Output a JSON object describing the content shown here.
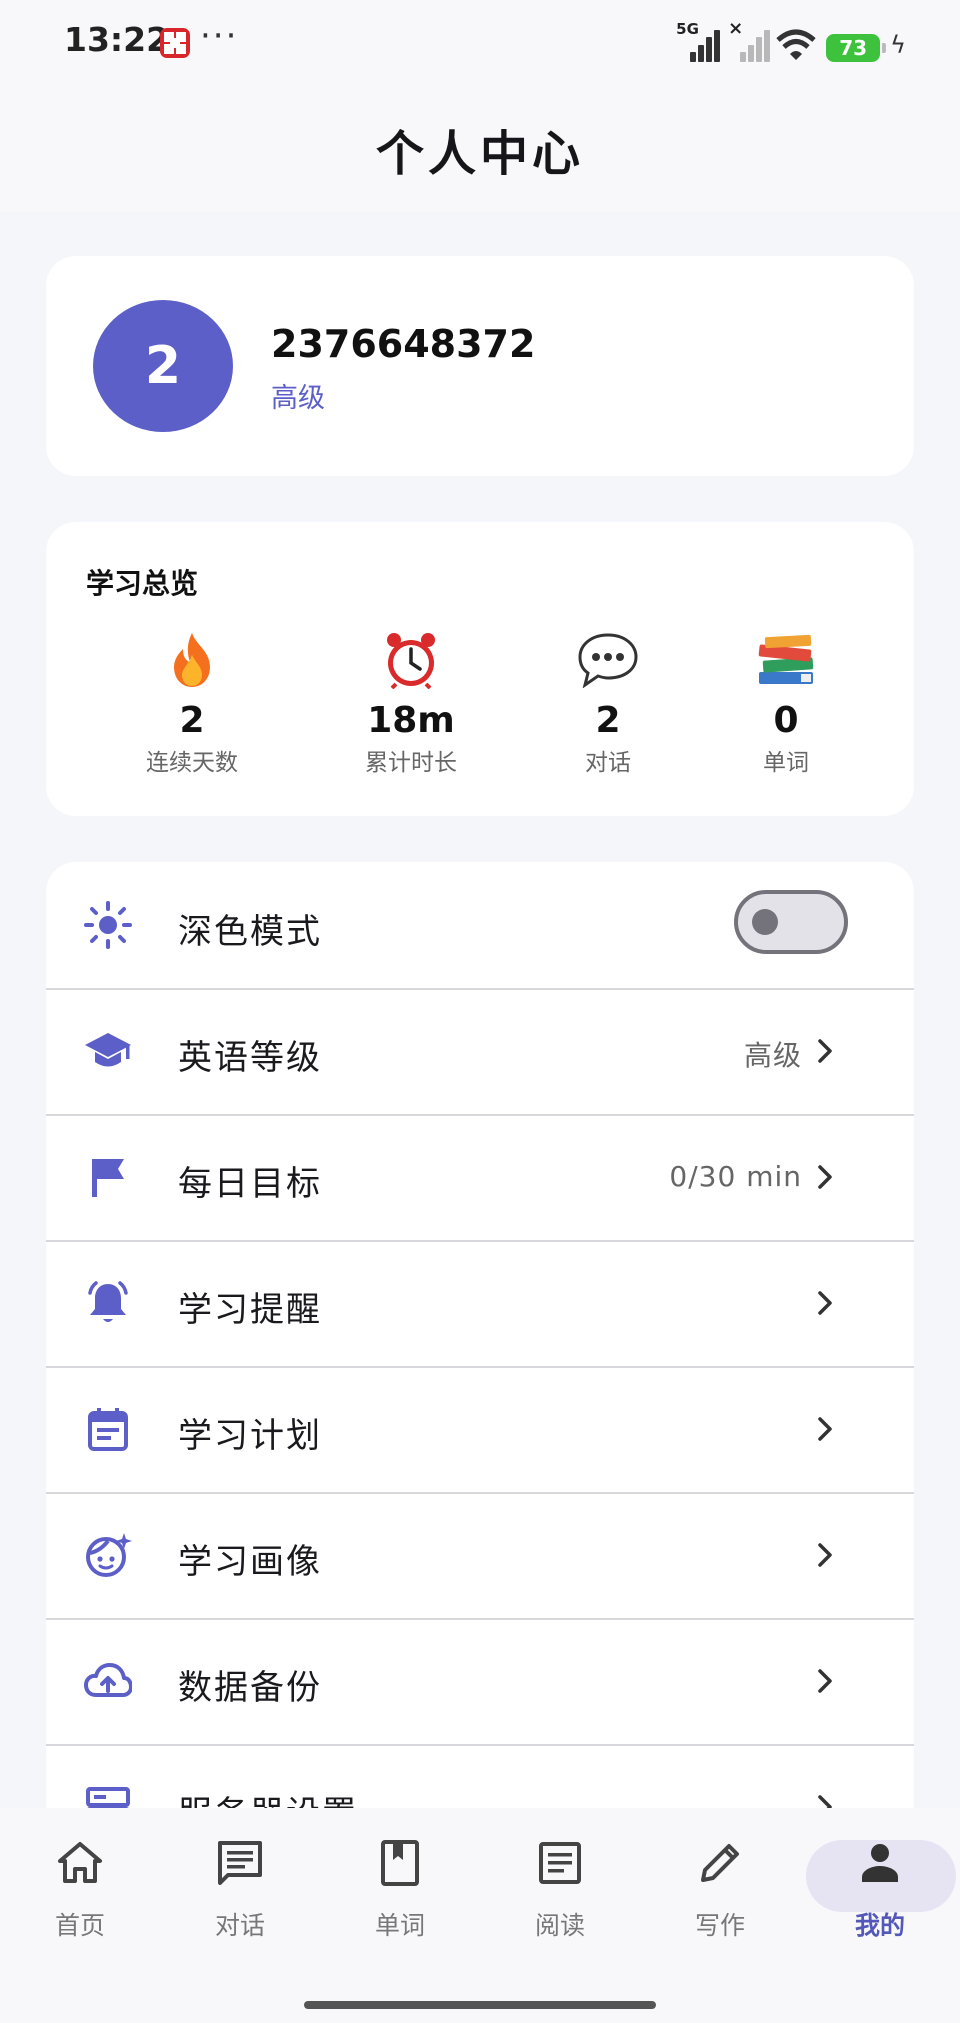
{
  "status_bar": {
    "time": "13:22",
    "dots": "···",
    "network_label": "5G",
    "battery": "73",
    "icons": [
      "app-notification-icon",
      "signal-icon",
      "signal-off-icon",
      "wifi-icon",
      "battery-icon",
      "charging-icon"
    ]
  },
  "header": {
    "title": "个人中心"
  },
  "profile": {
    "avatar_letter": "2",
    "username": "2376648372",
    "level": "高级",
    "avatar_color": "#5c5fc8"
  },
  "overview": {
    "title": "学习总览",
    "stats": [
      {
        "icon": "fire-icon",
        "value": "2",
        "label": "连续天数"
      },
      {
        "icon": "alarm-clock-icon",
        "value": "18m",
        "label": "累计时长"
      },
      {
        "icon": "speech-bubble-icon",
        "value": "2",
        "label": "对话"
      },
      {
        "icon": "books-icon",
        "value": "0",
        "label": "单词"
      }
    ]
  },
  "settings": {
    "items": [
      {
        "icon": "sun-icon",
        "label": "深色模式",
        "value": "",
        "type": "toggle",
        "toggle_on": false
      },
      {
        "icon": "graduation-cap-icon",
        "label": "英语等级",
        "value": "高级",
        "type": "link"
      },
      {
        "icon": "flag-icon",
        "label": "每日目标",
        "value": "0/30 min",
        "type": "link"
      },
      {
        "icon": "bell-icon",
        "label": "学习提醒",
        "value": "",
        "type": "link"
      },
      {
        "icon": "calendar-icon",
        "label": "学习计划",
        "value": "",
        "type": "link"
      },
      {
        "icon": "face-icon",
        "label": "学习画像",
        "value": "",
        "type": "link"
      },
      {
        "icon": "cloud-upload-icon",
        "label": "数据备份",
        "value": "",
        "type": "link"
      },
      {
        "icon": "server-icon",
        "label": "服务器设置",
        "value": "",
        "type": "link"
      }
    ]
  },
  "bottom_nav": {
    "items": [
      {
        "icon": "home-icon",
        "label": "首页",
        "active": false
      },
      {
        "icon": "chat-icon",
        "label": "对话",
        "active": false
      },
      {
        "icon": "bookmark-book-icon",
        "label": "单词",
        "active": false
      },
      {
        "icon": "article-icon",
        "label": "阅读",
        "active": false
      },
      {
        "icon": "pencil-icon",
        "label": "写作",
        "active": false
      },
      {
        "icon": "person-icon",
        "label": "我的",
        "active": true
      }
    ]
  },
  "colors": {
    "accent": "#5c5fc8",
    "active_nav_bg": "#e6e4f3",
    "background": "#f5f6fa"
  }
}
